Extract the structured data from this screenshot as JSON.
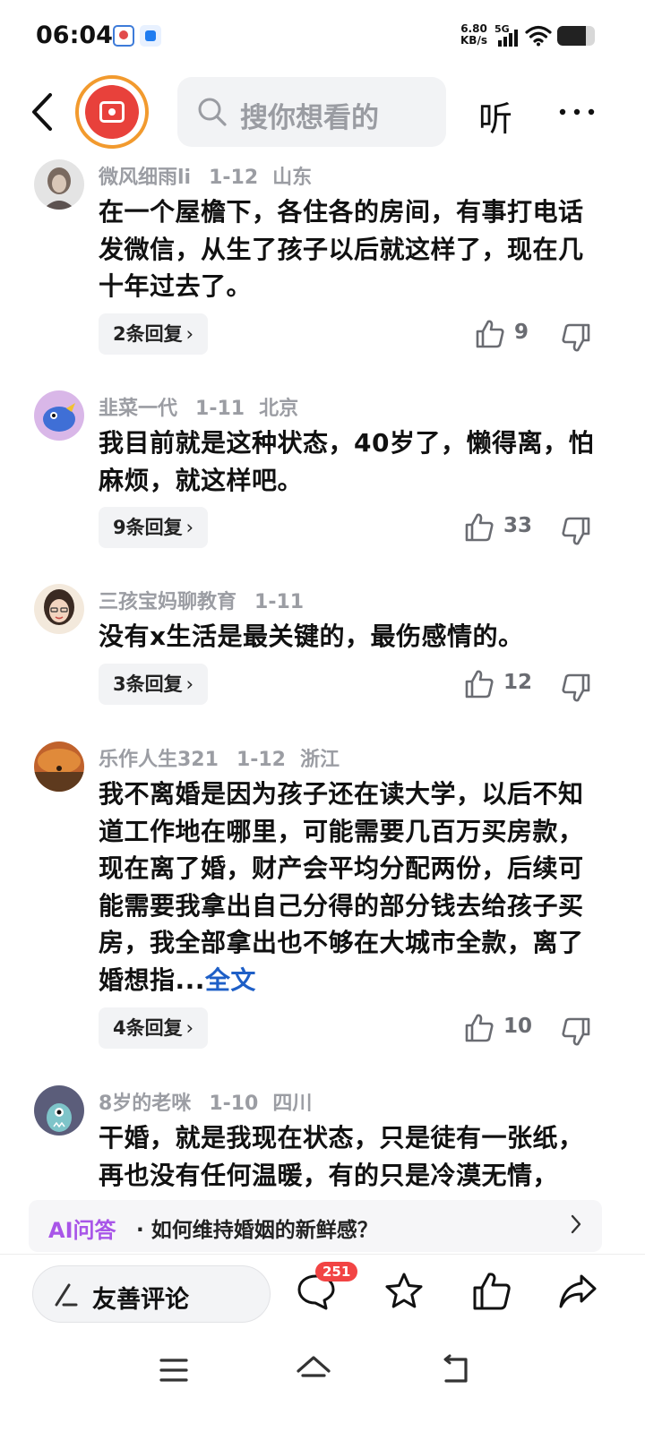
{
  "status_bar": {
    "time": "06:04",
    "net_speed_value": "6.80",
    "net_speed_unit": "KB/s",
    "network_type": "5G",
    "battery_level": 0.76
  },
  "header": {
    "search_placeholder": "搜你想看的",
    "listen_label": "听"
  },
  "comments": [
    {
      "user": "微风细雨li",
      "date": "1-12",
      "location": "山东",
      "text": "在一个屋檐下，各住各的房间，有事打电话发微信，从生了孩子以后就这样了，现在几十年过去了。",
      "full_text_link": "",
      "reply_label": "2条回复",
      "like_count": "9"
    },
    {
      "user": "韭菜一代",
      "date": "1-11",
      "location": "北京",
      "text": "我目前就是这种状态，40岁了，懒得离，怕麻烦，就这样吧。",
      "full_text_link": "",
      "reply_label": "9条回复",
      "like_count": "33"
    },
    {
      "user": "三孩宝妈聊教育",
      "date": "1-11",
      "location": "",
      "text": "没有x生活是最关键的，最伤感情的。",
      "full_text_link": "",
      "reply_label": "3条回复",
      "like_count": "12"
    },
    {
      "user": "乐作人生321",
      "date": "1-12",
      "location": "浙江",
      "text": "我不离婚是因为孩子还在读大学，以后不知道工作地在哪里，可能需要几百万买房款，现在离了婚，财产会平均分配两份，后续可能需要我拿出自己分得的部分钱去给孩子买房，我全部拿出也不够在大城市全款，离了婚想指...",
      "full_text_link": "全文",
      "reply_label": "4条回复",
      "like_count": "10"
    },
    {
      "user": "8岁的老咪",
      "date": "1-10",
      "location": "四川",
      "text": "干婚，就是我现在状态，只是徒有一张纸，再也没有任何温暖，有的只是冷漠无情，",
      "full_text_link": "",
      "reply_label": "",
      "like_count": ""
    }
  ],
  "ai_bar": {
    "label": "AI问答",
    "separator": "·",
    "question": "如何维持婚姻的新鲜感？"
  },
  "bottom_bar": {
    "comment_input_label": "友善评论",
    "comment_badge": "251"
  },
  "colors": {
    "accent_blue": "#1e5fc7",
    "ai_purple": "#a855e8",
    "badge_red": "#f24444",
    "logo_orange": "#f29a2e",
    "logo_red": "#e8413b"
  }
}
